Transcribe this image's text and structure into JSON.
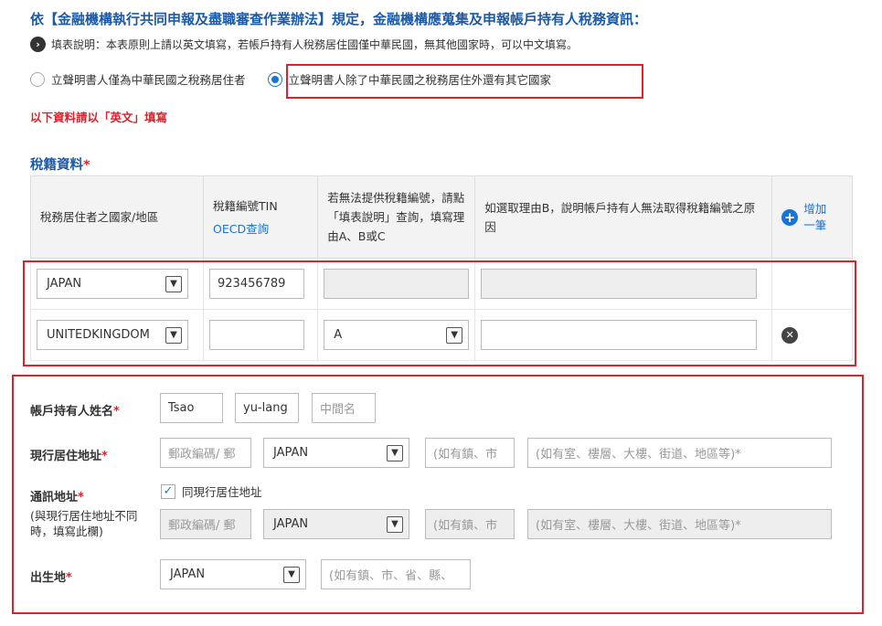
{
  "header": {
    "title": "依【金融機構執行共同申報及盡職審查作業辦法】規定，金融機構應蒐集及申報帳戶持有人稅務資訊：",
    "note": "填表說明：本表原則上請以英文填寫，若帳戶持有人稅務居住國僅中華民國，無其他國家時，可以中文填寫。",
    "note_icon": "chevron-right-icon"
  },
  "residency": {
    "option_1": "立聲明書人僅為中華民國之稅務居住者",
    "option_2": "立聲明書人除了中華民國之稅務居住外還有其它國家",
    "selected": 2
  },
  "english_notice": "以下資料請以「英文」填寫",
  "tax_section": {
    "title": "稅籍資料",
    "required_mark": "*",
    "headers": {
      "country": "稅務居住者之國家/地區",
      "tin": "稅籍編號TIN",
      "tin_link": "OECD查詢",
      "reason": "若無法提供稅籍編號，請點「填表說明」查詢，填寫理由A、B或C",
      "reason_b": "如選取理由B，說明帳戶持有人無法取得稅籍編號之原因",
      "add_label": "增加一筆"
    },
    "rows": [
      {
        "country": "JAPAN",
        "tin": "923456789",
        "reason": "",
        "reason_b": ""
      },
      {
        "country": "UNITEDKINGDOM",
        "tin": "",
        "reason": "A",
        "reason_b": ""
      }
    ]
  },
  "holder_form": {
    "name_label": "帳戶持有人姓名",
    "last_name": "Tsao",
    "first_name": "yu-lang",
    "middle_placeholder": "中間名",
    "address_label": "現行居住地址",
    "postal_placeholder": "郵政編碼/ 郵",
    "country_value": "JAPAN",
    "city_placeholder": "(如有鎮、市",
    "street_placeholder": "(如有室、樓層、大樓、街道、地區等)*",
    "mailing_label": "通訊地址",
    "same_as_label": "同現行居住地址",
    "same_as_checked": true,
    "mailing_note": "(與現行居住地址不同時，填寫此欄)",
    "mailing_postal_placeholder": "郵政編碼/ 郵",
    "mailing_country_value": "JAPAN",
    "mailing_city_placeholder": "(如有鎮、市",
    "mailing_street_placeholder": "(如有室、樓層、大樓、街道、地區等)*",
    "birthplace_label": "出生地",
    "birthplace_value": "JAPAN",
    "birthplace_city_placeholder": "(如有鎮、市、省、縣、",
    "required_mark": "*"
  },
  "colors": {
    "accent": "#1a5aa8",
    "link": "#1a73d9",
    "alert": "#e0202a"
  }
}
